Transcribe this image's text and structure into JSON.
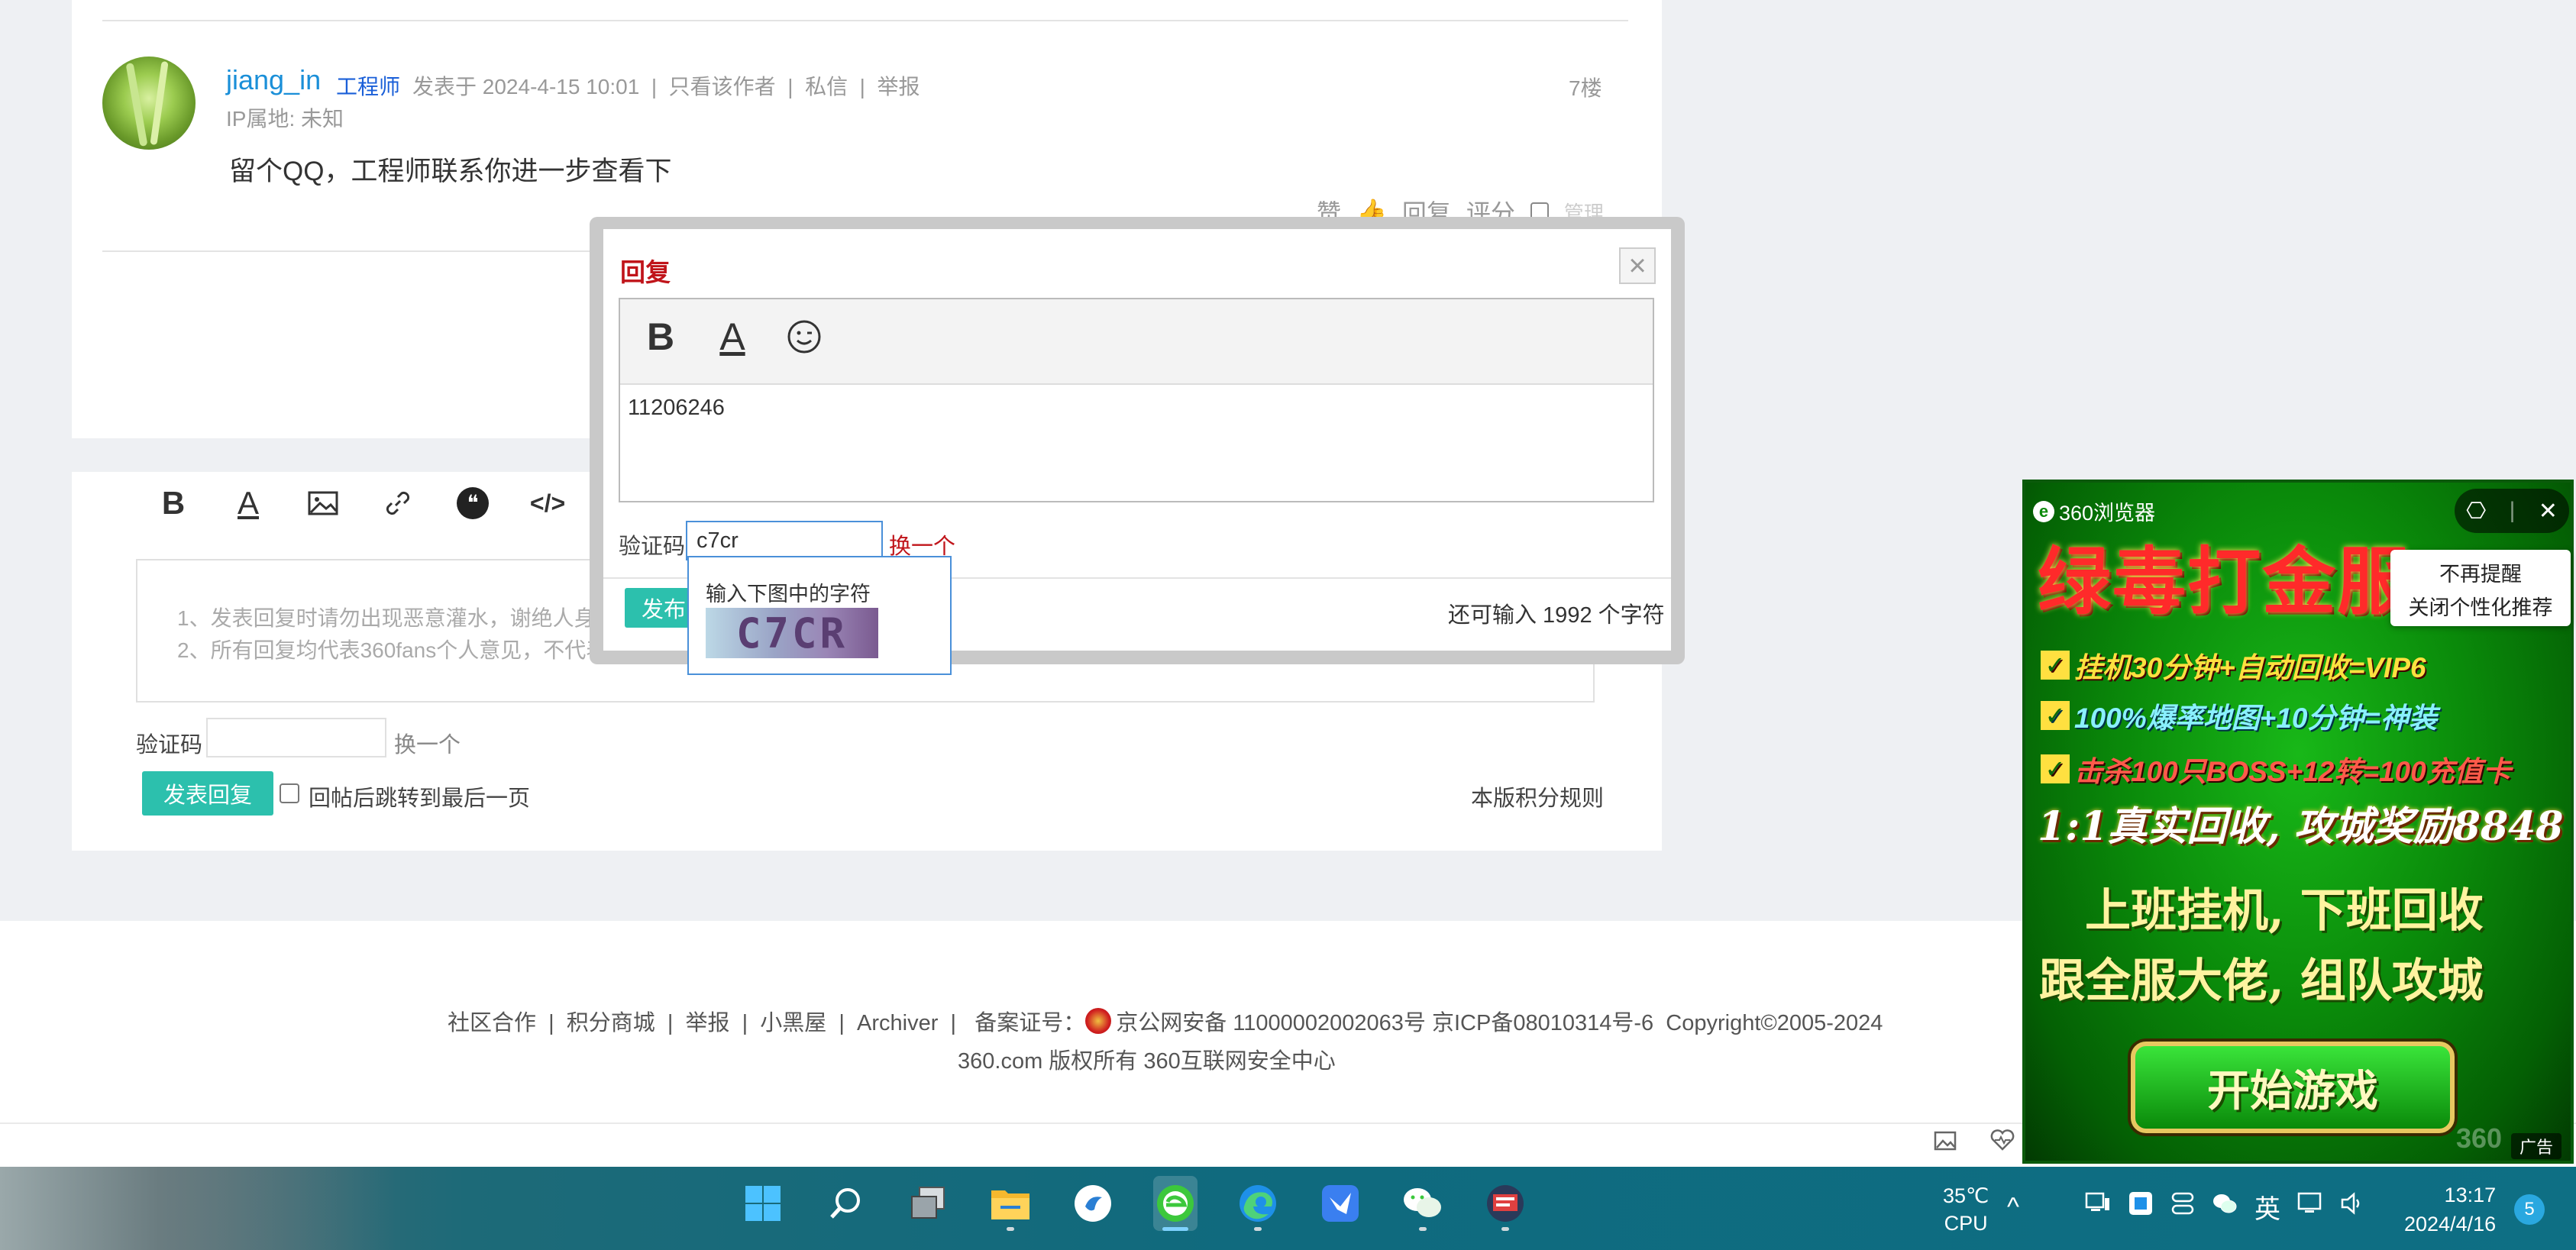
{
  "post": {
    "author": "jiang_in",
    "role": "工程师",
    "meta": "发表于 2024-4-15 10:01  |  只看该作者  |  私信  |  举报",
    "ip": "IP属地: 未知",
    "floor": "7楼",
    "content": "留个QQ，工程师联系你进一步查看下",
    "actions": {
      "like": "赞",
      "reply": "回复",
      "rate": "评分",
      "manage": "管理"
    }
  },
  "reply_panel": {
    "rules": [
      "1、发表回复时请勿出现恶意灌水，谢绝人身攻",
      "2、所有回复均代表360fans个人意见，不代表"
    ],
    "captcha_label": "验证码",
    "captcha_change": "换一个",
    "submit": "发表回复",
    "jump_label": "回帖后跳转到最后一页",
    "score_rules": "本版积分规则"
  },
  "modal": {
    "title": "回复",
    "close": "×",
    "text": "11206246",
    "captcha_label": "验证码",
    "captcha_value": "c7cr",
    "captcha_change": "换一个",
    "submit": "发布",
    "remaining": "还可输入 1992 个字符",
    "captcha_hint": "输入下图中的字符",
    "captcha_image_text": "C7CR"
  },
  "footer": {
    "links": "社区合作  |  积分商城  |  举报  |  小黑屋  |  Archiver  |   备案证号：",
    "icp": "京公网安备 11000002002063号 京ICP备08010314号-6  Copyright©2005-2024",
    "copyright": "360.com 版权所有 360互联网安全中心"
  },
  "ad": {
    "brand": "360浏览器",
    "menu": [
      "不再提醒",
      "关闭个性化推荐"
    ],
    "headline": "绿毒打金服",
    "features": [
      "挂机30分钟+自动回收=VIP6",
      "100%爆率地图+10分钟=神装",
      "击杀100只BOSS+12转=100充值卡"
    ],
    "feature4": "1:1真实回收, 攻城奖励8848",
    "slogan1": "上班挂机, 下班回收",
    "slogan2": "跟全服大佬, 组队攻城",
    "play": "开始游戏",
    "watermark": "360",
    "tag": "广告"
  },
  "taskbar": {
    "weather_temp": "35℃",
    "weather_label": "CPU",
    "ime": "英",
    "time": "13:17",
    "date": "2024/4/16",
    "notifications": "5",
    "apps": [
      "windows-start",
      "search",
      "task-view",
      "file-explorer",
      "app-circle",
      "360-browser",
      "edge",
      "feishu",
      "wechat",
      "terminal"
    ]
  },
  "colors": {
    "accent": "#2cc0ad",
    "link": "#1a8fd8",
    "title_red": "#c0141a"
  }
}
